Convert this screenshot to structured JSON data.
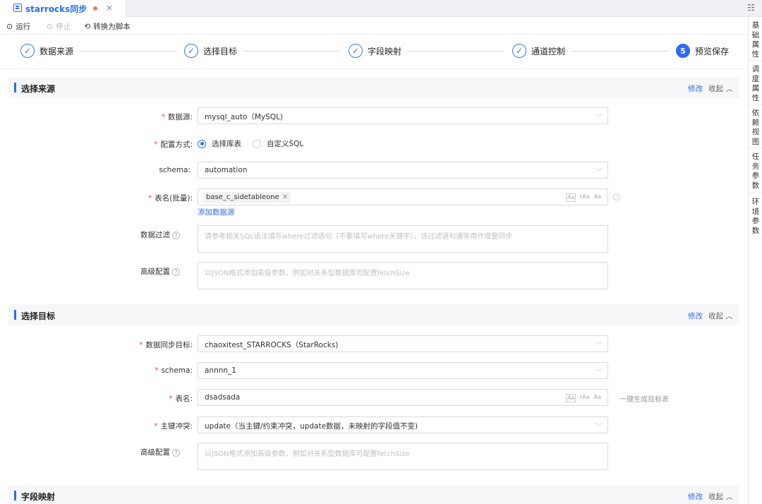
{
  "tab": {
    "title": "starrocks同步",
    "close_label": "×"
  },
  "toolbar": {
    "run_label": "运行",
    "stop_label": "停止",
    "convert_label": "转换为脚本"
  },
  "steps": [
    {
      "label": "数据来源",
      "status": "done",
      "mark": "✓"
    },
    {
      "label": "选择目标",
      "status": "done",
      "mark": "✓"
    },
    {
      "label": "字段映射",
      "status": "done",
      "mark": "✓"
    },
    {
      "label": "通道控制",
      "status": "done",
      "mark": "✓"
    },
    {
      "label": "预览保存",
      "status": "active",
      "mark": "5"
    }
  ],
  "source": {
    "title": "选择来源",
    "edit": "修改",
    "collapse": "收起",
    "datasource_label": "数据源:",
    "datasource_value": "mysql_auto（MySQL)",
    "config_label": "配置方式:",
    "config_options": [
      "选择库表",
      "自定义SQL"
    ],
    "schema_label": "schema:",
    "schema_value": "automation",
    "table_label": "表名(批量):",
    "table_tag": "base_c_sidetableone",
    "add_datasource": "添加数据源",
    "filter_label": "数据过滤",
    "filter_placeholder": "请参考相关SQL语法填写where过滤语句（不要填写where关键字）。该过滤语句通常用作增量同步",
    "advanced_label": "高级配置",
    "advanced_placeholder": "以JSON格式添加高级参数，例如对关系型数据库可配置fetchSize"
  },
  "target": {
    "title": "选择目标",
    "edit": "修改",
    "collapse": "收起",
    "target_label": "数据同步目标:",
    "target_value": "chaoxitest_STARROCKS（StarRocks)",
    "schema_label": "schema:",
    "schema_value": "annnn_1",
    "table_label": "表名:",
    "table_value": "dsadsada",
    "generate_hint": "一键生成目标表",
    "conflict_label": "主键冲突:",
    "conflict_value": "update（当主键/约束冲突，update数据，未映射的字段值不变)",
    "advanced_label": "高级配置",
    "advanced_placeholder": "以JSON格式添加高级参数，例如对关系型数据库可配置fetchSize"
  },
  "mapping": {
    "title": "字段映射",
    "edit": "修改",
    "collapse": "收起"
  },
  "rail": [
    "基础属性",
    "调度属性",
    "依赖视图",
    "任务参数",
    "环境参数"
  ]
}
